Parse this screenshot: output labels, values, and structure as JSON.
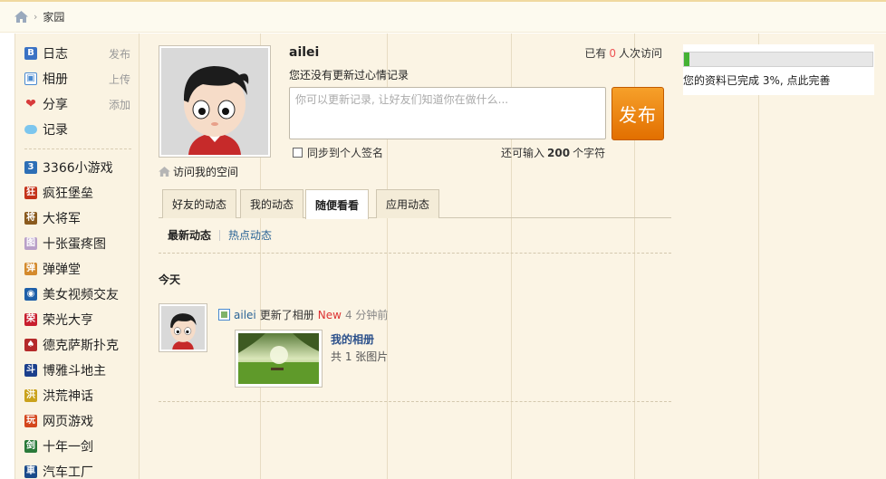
{
  "breadcrumb": {
    "current": "家园"
  },
  "sidebar": {
    "main_items": [
      {
        "label": "日志",
        "action": "发布",
        "icon": "blog-icon",
        "color": "#3a72c4"
      },
      {
        "label": "相册",
        "action": "上传",
        "icon": "album-icon",
        "color": "#4a8ad0"
      },
      {
        "label": "分享",
        "action": "添加",
        "icon": "heart-share-icon",
        "color": "#d83b3b"
      },
      {
        "label": "记录",
        "action": "",
        "icon": "speech-bubble-icon",
        "color": "#3fa4e0"
      }
    ],
    "apps": [
      {
        "label": "3366小游戏",
        "icon": "game-3366-icon",
        "color": "#2d6fb6",
        "glyph": "3"
      },
      {
        "label": "疯狂堡垒",
        "icon": "crazy-fort-icon",
        "color": "#c4331a",
        "glyph": "狂"
      },
      {
        "label": "大将军",
        "icon": "general-icon",
        "color": "#8a5a1e",
        "glyph": "将"
      },
      {
        "label": "十张蛋疼图",
        "icon": "ten-pics-icon",
        "color": "#b9a0c8",
        "glyph": "图"
      },
      {
        "label": "弹弹堂",
        "icon": "ddtank-icon",
        "color": "#d48a2c",
        "glyph": "弹"
      },
      {
        "label": "美女视频交友",
        "icon": "video-dating-icon",
        "color": "#1e5fa8",
        "glyph": "◉"
      },
      {
        "label": "荣光大亨",
        "icon": "tycoon-icon",
        "color": "#c81e2e",
        "glyph": "荣"
      },
      {
        "label": "德克萨斯扑克",
        "icon": "poker-icon",
        "color": "#b52a2a",
        "glyph": "♠"
      },
      {
        "label": "博雅斗地主",
        "icon": "doudizhu-icon",
        "color": "#1b3f8c",
        "glyph": "斗"
      },
      {
        "label": "洪荒神话",
        "icon": "myth-icon",
        "color": "#caa21c",
        "glyph": "洪"
      },
      {
        "label": "网页游戏",
        "icon": "webgame-icon",
        "color": "#d4461c",
        "glyph": "玩"
      },
      {
        "label": "十年一剑",
        "icon": "sword-icon",
        "color": "#2a7a3a",
        "glyph": "剑"
      },
      {
        "label": "汽车工厂",
        "icon": "car-factory-icon",
        "color": "#1a4a8a",
        "glyph": "車"
      }
    ]
  },
  "profile": {
    "username": "ailei",
    "visits_prefix": "已有",
    "visits_count": "0",
    "visits_suffix": "人次访问",
    "mood": "您还没有更新过心情记录",
    "status_placeholder": "你可以更新记录, 让好友们知道你在做什么...",
    "publish_label": "发布",
    "sync_label": "同步到个人签名",
    "chars_prefix": "还可输入",
    "chars_count": "200",
    "chars_suffix": "个字符",
    "visit_space": "访问我的空间"
  },
  "tabs": [
    "好友的动态",
    "我的动态",
    "随便看看",
    "应用动态"
  ],
  "active_tab": 2,
  "subtabs": {
    "latest": "最新动态",
    "hot": "热点动态"
  },
  "feed": {
    "day": "今天",
    "user": "ailei",
    "action": "更新了相册",
    "badge": "New",
    "time": "4 分钟前",
    "album_title": "我的相册",
    "album_count": "共 1 张图片"
  },
  "completion": {
    "percent": 3,
    "text": "您的资料已完成 3%, 点此完善"
  },
  "colors": {
    "accent_orange": "#e57300",
    "progress_green": "#45b233",
    "link_blue": "#2a6496",
    "new_red": "#d33333"
  }
}
